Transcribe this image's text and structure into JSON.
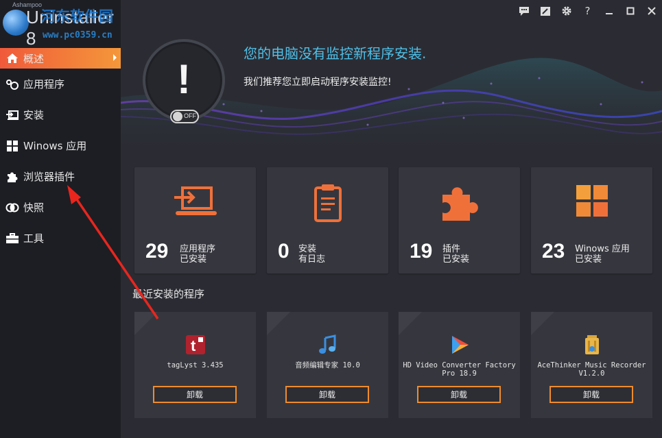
{
  "logo": {
    "brand_small": "Ashampoo",
    "product": "Uninstaller 8",
    "watermark": "河东软件园",
    "watermark_url": "www.pc0359.cn"
  },
  "topbar": {
    "icons": [
      "feedback-icon",
      "edit-icon",
      "gear-icon",
      "help-icon",
      "minimize-icon",
      "maximize-icon",
      "close-icon"
    ],
    "help_label": "?"
  },
  "sidebar": {
    "items": [
      {
        "label": "概述",
        "icon": "home-icon",
        "active": true
      },
      {
        "label": "应用程序",
        "icon": "apps-icon"
      },
      {
        "label": "安装",
        "icon": "install-icon"
      },
      {
        "label": "Winows 应用",
        "icon": "windows-icon"
      },
      {
        "label": "浏览器插件",
        "icon": "puzzle-icon"
      },
      {
        "label": "快照",
        "icon": "snapshot-icon"
      },
      {
        "label": "工具",
        "icon": "toolbox-icon"
      }
    ]
  },
  "hero": {
    "title": "您的电脑没有监控新程序安装.",
    "subtitle": "我们推荐您立即启动程序安装监控!",
    "alert_symbol": "!",
    "toggle_label": "OFF"
  },
  "stats": [
    {
      "count": "29",
      "line1": "应用程序",
      "line2": "已安装",
      "icon": "laptop-install-icon"
    },
    {
      "count": "0",
      "line1": "安装",
      "line2": "有日志",
      "icon": "clipboard-icon"
    },
    {
      "count": "19",
      "line1": "插件",
      "line2": "已安装",
      "icon": "puzzle-icon"
    },
    {
      "count": "23",
      "line1": "Winows 应用",
      "line2": "已安装",
      "icon": "windows-tiles-icon"
    }
  ],
  "recent": {
    "title": "最近安装的程序",
    "apps": [
      {
        "name": "tagLyst 3.435",
        "button": "卸载",
        "icon": "taglyst-icon"
      },
      {
        "name": "音频编辑专家 10.0",
        "button": "卸载",
        "icon": "music-note-icon"
      },
      {
        "name": "HD Video Converter Factory Pro 18.9",
        "button": "卸载",
        "icon": "video-play-icon"
      },
      {
        "name": "AceThinker Music Recorder V1.2.0",
        "button": "卸载",
        "icon": "recorder-bin-icon"
      }
    ]
  },
  "colors": {
    "accent": "#f08c2e",
    "hero_title": "#4fc0e8",
    "sidebar_bg": "#1d1e23",
    "card_bg": "#36373e"
  }
}
